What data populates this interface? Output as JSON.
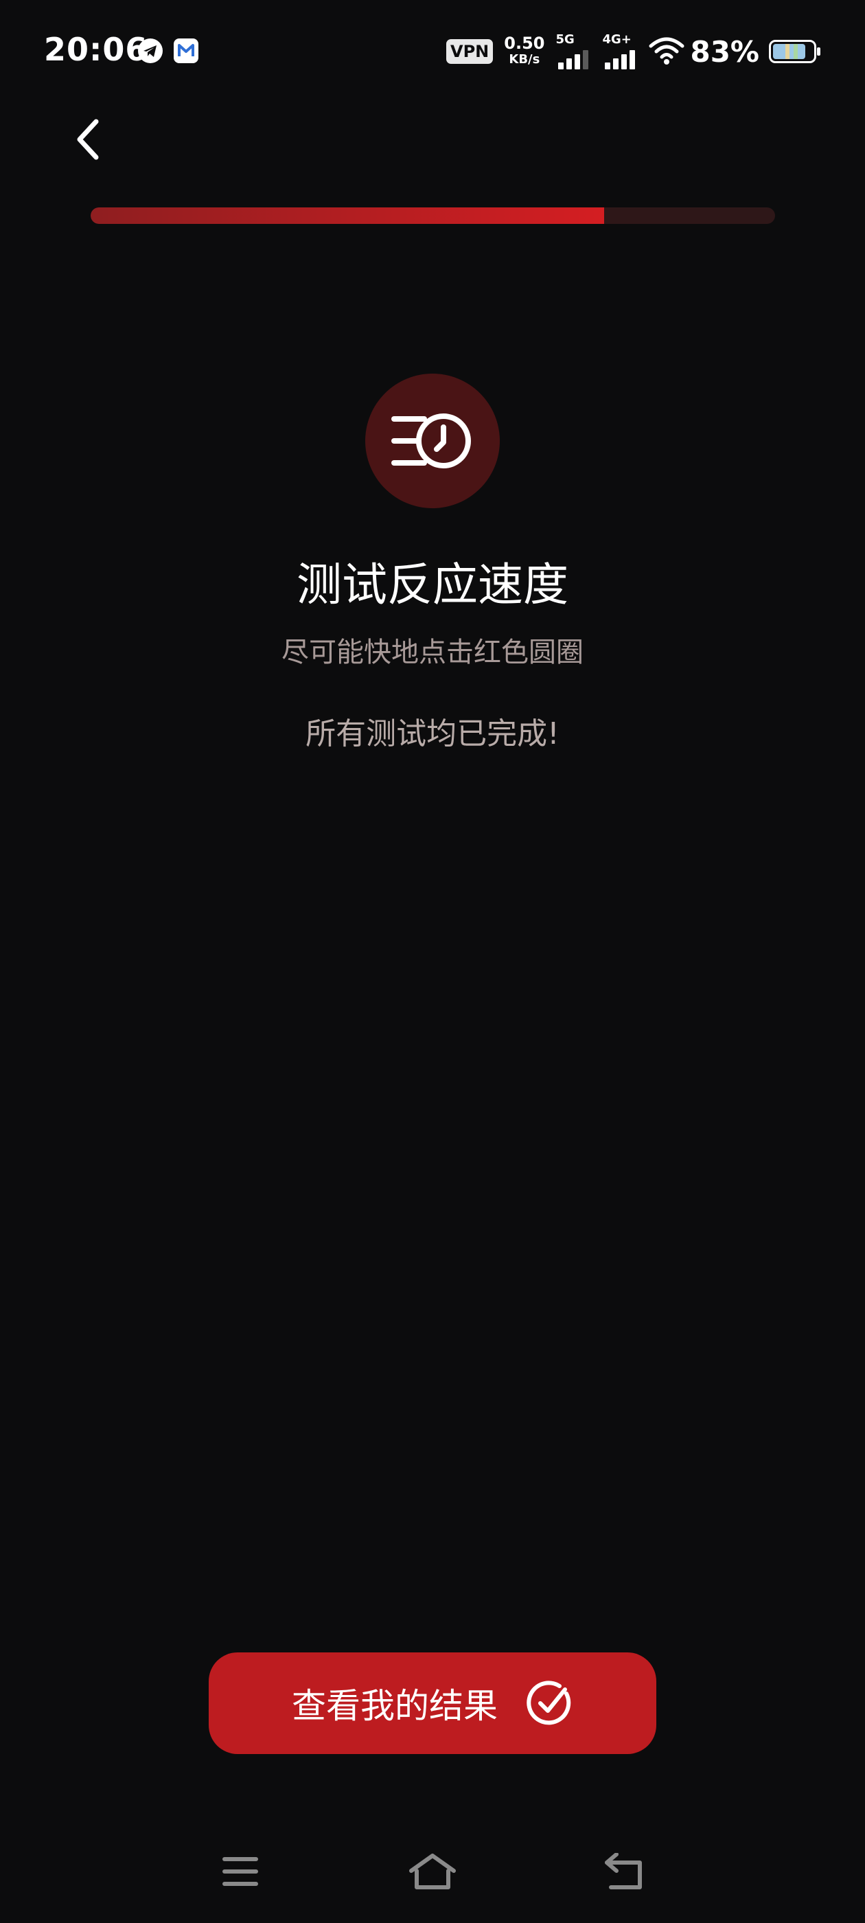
{
  "status_bar": {
    "time": "20:06",
    "app_icons": [
      "telegram-icon",
      "mail-icon"
    ],
    "vpn_label": "VPN",
    "net_speed_value": "0.50",
    "net_speed_unit": "KB/s",
    "sim1_label": "5G",
    "sim2_label": "4G+",
    "battery_percent": "83%",
    "battery_level": 0.83
  },
  "header": {
    "back_icon": "chevron-left-icon"
  },
  "progress": {
    "fraction": 0.75,
    "fill_color": "#d41e22",
    "track_color": "#2e1718"
  },
  "main": {
    "hero_icon": "speed-clock-icon",
    "title": "测试反应速度",
    "subtitle": "尽可能快地点击红色圆圈",
    "status": "所有测试均已完成!"
  },
  "result_button": {
    "label": "查看我的结果",
    "icon": "check-circle-icon",
    "color": "#bd1c20"
  },
  "nav_bar": {
    "icons": [
      "menu-icon",
      "home-icon",
      "back-icon"
    ]
  }
}
